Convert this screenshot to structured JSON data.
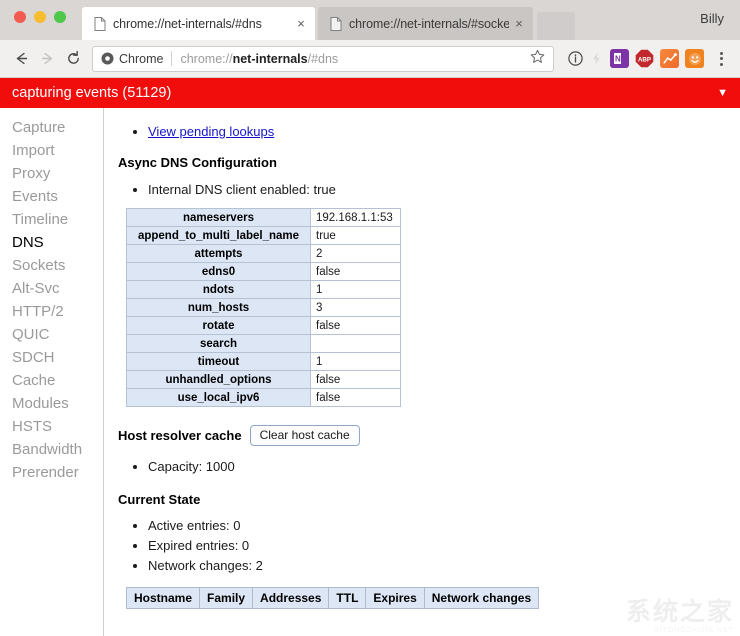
{
  "browser": {
    "profile_name": "Billy",
    "tabs": [
      {
        "title": "chrome://net-internals/#dns",
        "close_label": "×",
        "active": true
      },
      {
        "title": "chrome://net-internals/#socke",
        "close_label": "×",
        "active": false
      }
    ],
    "toolbar": {
      "back_icon": "back-arrow-icon",
      "forward_icon": "forward-arrow-icon",
      "reload_icon": "reload-icon",
      "security_label": "Chrome",
      "url_prefix": "chrome://",
      "url_bold": "net-internals",
      "url_suffix": "/#dns",
      "star_icon": "bookmark-star-icon",
      "page_info_icon": "page-info-icon",
      "flash_icon": "flash-icon",
      "extensions": [
        {
          "name": "onenote-extension-icon",
          "label": "N",
          "color": "#7b33a5"
        },
        {
          "name": "adblock-plus-extension-icon",
          "label": "ABP",
          "color": "#c1272d"
        },
        {
          "name": "chart-extension-icon",
          "label": "",
          "color": "#ef6a2b"
        },
        {
          "name": "smiley-extension-icon",
          "label": "",
          "color": "#f0821f"
        }
      ],
      "menu_icon": "three-dot-menu-icon"
    }
  },
  "capture_bar": {
    "text": "capturing events (51129)",
    "caret": "▼",
    "color": "#f20d0d"
  },
  "sidebar": {
    "items": [
      {
        "label": "Capture",
        "selected": false
      },
      {
        "label": "Import",
        "selected": false
      },
      {
        "label": "Proxy",
        "selected": false
      },
      {
        "label": "Events",
        "selected": false
      },
      {
        "label": "Timeline",
        "selected": false
      },
      {
        "label": "DNS",
        "selected": true
      },
      {
        "label": "Sockets",
        "selected": false
      },
      {
        "label": "Alt-Svc",
        "selected": false
      },
      {
        "label": "HTTP/2",
        "selected": false
      },
      {
        "label": "QUIC",
        "selected": false
      },
      {
        "label": "SDCH",
        "selected": false
      },
      {
        "label": "Cache",
        "selected": false
      },
      {
        "label": "Modules",
        "selected": false
      },
      {
        "label": "HSTS",
        "selected": false
      },
      {
        "label": "Bandwidth",
        "selected": false
      },
      {
        "label": "Prerender",
        "selected": false
      }
    ]
  },
  "main": {
    "pending_lookups_link": "View pending lookups",
    "async_heading": "Async DNS Configuration",
    "internal_dns_line": "Internal DNS client enabled: true",
    "config_table": {
      "rows": [
        {
          "key": "nameservers",
          "value": "192.168.1.1:53"
        },
        {
          "key": "append_to_multi_label_name",
          "value": "true"
        },
        {
          "key": "attempts",
          "value": "2"
        },
        {
          "key": "edns0",
          "value": "false"
        },
        {
          "key": "ndots",
          "value": "1"
        },
        {
          "key": "num_hosts",
          "value": "3"
        },
        {
          "key": "rotate",
          "value": "false"
        },
        {
          "key": "search",
          "value": ""
        },
        {
          "key": "timeout",
          "value": "1"
        },
        {
          "key": "unhandled_options",
          "value": "false"
        },
        {
          "key": "use_local_ipv6",
          "value": "false"
        }
      ]
    },
    "host_resolver_label": "Host resolver cache",
    "clear_host_cache_button": "Clear host cache",
    "capacity_line": "Capacity: 1000",
    "current_state_heading": "Current State",
    "state_lines": [
      "Active entries: 0",
      "Expired entries: 0",
      "Network changes: 2"
    ],
    "cache_table": {
      "headers": [
        "Hostname",
        "Family",
        "Addresses",
        "TTL",
        "Expires",
        "Network changes"
      ],
      "rows": []
    }
  },
  "watermark": {
    "line1": "系统之家",
    "line2": "XITONGZHIJIA.NET"
  }
}
